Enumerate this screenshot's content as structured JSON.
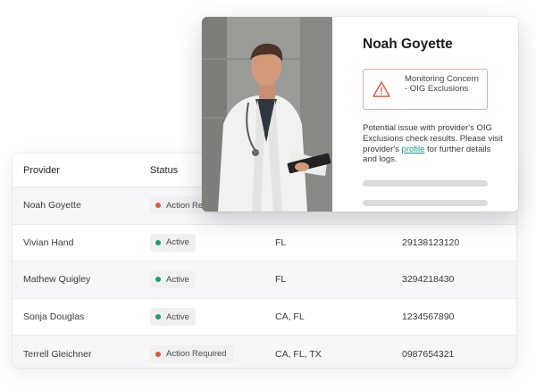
{
  "table": {
    "headers": {
      "provider": "Provider",
      "status": "Status"
    },
    "rows": [
      {
        "provider": "Noah Goyette",
        "status": "Action Required",
        "status_color": "#e5553b",
        "state": "",
        "npi": ""
      },
      {
        "provider": "Vivian Hand",
        "status": "Active",
        "status_color": "#1f9d6a",
        "state": "FL",
        "npi": "29138123120"
      },
      {
        "provider": "Mathew Quigley",
        "status": "Active",
        "status_color": "#1f9d6a",
        "state": "FL",
        "npi": "3294218430"
      },
      {
        "provider": "Sonja Douglas",
        "status": "Active",
        "status_color": "#1f9d6a",
        "state": "CA, FL",
        "npi": "1234567890"
      },
      {
        "provider": "Terrell Gleichner",
        "status": "Action Required",
        "status_color": "#e5553b",
        "state": "CA, FL, TX",
        "npi": "0987654321"
      }
    ]
  },
  "popup": {
    "name": "Noah Goyette",
    "alert": {
      "icon": "warning-triangle-icon",
      "text": "Monitoring Concern - OIG Exclusions",
      "color": "#e5553b"
    },
    "description_before": "Potential issue with provider's OIG Exclusions check results. Please visit provider's ",
    "link_label": "profile",
    "description_after": " for further details and logs.",
    "link_color": "#16a089"
  }
}
